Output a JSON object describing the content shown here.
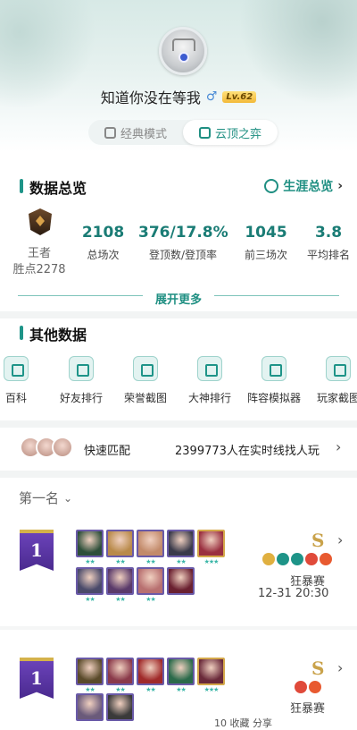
{
  "profile": {
    "name": "知道你没在等我",
    "gender_icon": "male-symbol-icon",
    "level": "Lv.62"
  },
  "modes": [
    {
      "label": "经典模式",
      "active": false
    },
    {
      "label": "云顶之弈",
      "active": true
    }
  ],
  "overview": {
    "title": "数据总览",
    "career_label": "生涯总览",
    "rank": {
      "tier": "王者",
      "points": "胜点2278"
    },
    "stats": [
      {
        "value": "2108",
        "label": "总场次"
      },
      {
        "value": "376/17.8%",
        "label": "登顶数/登顶率"
      },
      {
        "value": "1045",
        "label": "前三场次"
      },
      {
        "value": "3.8",
        "label": "平均排名"
      }
    ],
    "expand_label": "展开更多"
  },
  "other": {
    "title": "其他数据",
    "tools": [
      {
        "label": "百科",
        "icon": "book-icon"
      },
      {
        "label": "好友排行",
        "icon": "friends-icon"
      },
      {
        "label": "荣誉截图",
        "icon": "crop-icon"
      },
      {
        "label": "大神排行",
        "icon": "bar-chart-icon"
      },
      {
        "label": "阵容模拟器",
        "icon": "hexagon-icon"
      },
      {
        "label": "玩家截图",
        "icon": "image-icon"
      }
    ]
  },
  "quick_match": {
    "label": "快速匹配",
    "online_text": "2399773人在实时线找人玩"
  },
  "filter": {
    "label": "第一名"
  },
  "matches": [
    {
      "placement": "1",
      "grade": "S",
      "mode": "狂暴赛",
      "time": "12-31 20:30",
      "units_row1": [
        {
          "stars": "★★",
          "color": "#2e4f3a"
        },
        {
          "stars": "★★",
          "color": "#b98a4a"
        },
        {
          "stars": "★★",
          "color": "#c28a6a"
        },
        {
          "stars": "★★",
          "color": "#3a3a4a"
        },
        {
          "stars": "★★★",
          "color": "#9a3040"
        }
      ],
      "units_row2": [
        {
          "stars": "★★",
          "color": "#4a4a6a"
        },
        {
          "stars": "★★",
          "color": "#5a3a6a"
        },
        {
          "stars": "★★",
          "color": "#b87070"
        },
        {
          "stars": "",
          "color": "#6a2030"
        }
      ]
    },
    {
      "placement": "1",
      "grade": "S",
      "mode": "狂暴赛",
      "time": "",
      "units_row1": [
        {
          "stars": "★★",
          "color": "#5a4a2a"
        },
        {
          "stars": "★★",
          "color": "#8a3a4a"
        },
        {
          "stars": "★★",
          "color": "#a02a2a"
        },
        {
          "stars": "★★",
          "color": "#2a6a4a"
        },
        {
          "stars": "★★★",
          "color": "#6a2a3a"
        }
      ],
      "units_row2": [
        {
          "stars": "",
          "color": "#6a5a7a"
        },
        {
          "stars": "",
          "color": "#3a3a3a"
        }
      ]
    }
  ],
  "bottom_bar": {
    "text": "10   收藏   分享"
  }
}
